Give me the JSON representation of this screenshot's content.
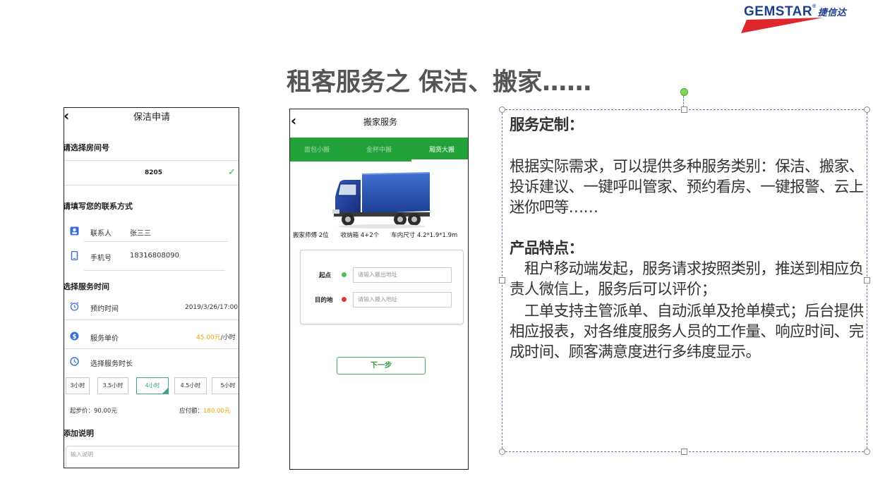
{
  "logo": {
    "brand": "GEMSTAR",
    "reg": "®",
    "cn": "捷信达",
    "colors": {
      "blue": "#1d3f8f",
      "red": "#e0262d"
    }
  },
  "slide_title": "租客服务之 保洁、搬家……",
  "cleaning": {
    "back_icon": "chevron-left-icon",
    "title": "保洁申请",
    "room_label": "请选择房间号",
    "room_value": "8205",
    "contact_label": "请填写您的联系方式",
    "contact_person_label": "联系人",
    "contact_person_value": "张三三",
    "phone_label": "手机号",
    "phone_value": "18316808090",
    "time_section_label": "选择服务时间",
    "appointment_label": "预约时间",
    "appointment_value": "2019/3/26/17:00",
    "price_label": "服务单价",
    "price_value": "45.00元",
    "price_unit": "/小时",
    "duration_label": "选择服务时长",
    "durations": [
      "3小时",
      "3.5小时",
      "4小时",
      "4.5小时",
      "5小时"
    ],
    "selected_duration": "4小时",
    "start_price": "起步价：90.00元",
    "payable_label": "应付额：",
    "payable_value": "180.00元",
    "note_label": "添加说明",
    "note_placeholder": "输入说明",
    "colors": {
      "accent": "#3aa38a",
      "price": "#f5a100",
      "check": "#35b04a"
    }
  },
  "moving": {
    "title": "搬家服务",
    "tabs": [
      "面包小搬",
      "金杯中搬",
      "厢货大搬"
    ],
    "active_tab": "厢货大搬",
    "specs": "搬家师傅 2位　　收纳箱 4+2个　　车内尺寸 4.2*1.9*1.9m",
    "from_label": "起点",
    "from_placeholder": "请输入搬出地址",
    "to_label": "目的地",
    "to_placeholder": "请输入搬入地址",
    "next_button": "下一步",
    "colors": {
      "tab_bar": "#22a33a",
      "from_dot": "#5cb85c",
      "to_dot": "#d9363e"
    }
  },
  "description": {
    "heading1": "服务定制：",
    "para1": "根据实际需求，可以提供多种服务类别：保洁、搬家、投诉建议、一键呼叫管家、预约看房、一键报警、云上迷你吧等……",
    "heading2": "产品特点：",
    "para2": "　租户移动端发起，服务请求按照类别，推送到相应负责人微信上，服务后可以评价；",
    "para3": "　工单支持主管派单、自动派单及抢单模式；后台提供相应报表，对各维度服务人员的工作量、响应时间、完成时间、顾客满意度进行多纬度显示。"
  }
}
